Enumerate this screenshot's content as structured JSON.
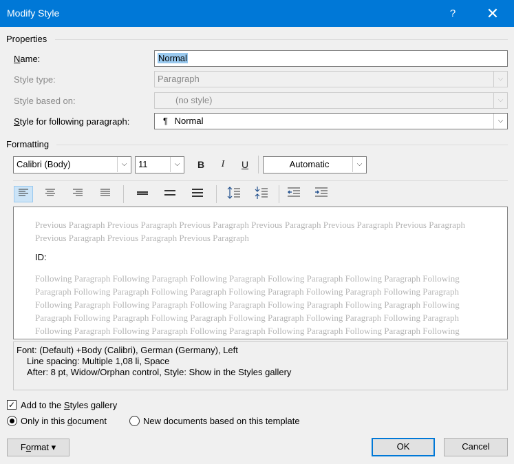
{
  "window": {
    "title": "Modify Style",
    "help_label": "?",
    "close_label": "✕"
  },
  "properties": {
    "header": "Properties",
    "name_label": "Name:",
    "name_value": "Normal",
    "style_type_label": "Style type:",
    "style_type_value": "Paragraph",
    "based_on_label": "Style based on:",
    "based_on_value": "(no style)",
    "following_label": "Style for following paragraph:",
    "following_value": "Normal",
    "pilcrow": "¶"
  },
  "formatting": {
    "header": "Formatting",
    "font": "Calibri (Body)",
    "size": "11",
    "bold": "B",
    "italic": "I",
    "underline": "U",
    "color": "Automatic"
  },
  "preview": {
    "previous_text": "Previous Paragraph Previous Paragraph Previous Paragraph Previous Paragraph Previous Paragraph Previous Paragraph Previous Paragraph Previous Paragraph Previous Paragraph",
    "current_text": "ID:",
    "following_text": "Following Paragraph Following Paragraph Following Paragraph Following Paragraph Following Paragraph Following Paragraph Following Paragraph Following Paragraph Following Paragraph Following Paragraph Following Paragraph Following Paragraph Following Paragraph Following Paragraph Following Paragraph Following Paragraph Following Paragraph Following Paragraph Following Paragraph Following Paragraph Following Paragraph Following Paragraph Following Paragraph Following Paragraph Following Paragraph Following Paragraph Following Paragraph Following Paragraph Following Paragraph Following Paragraph"
  },
  "description": {
    "line1": "Font: (Default) +Body (Calibri), German (Germany), Left",
    "line2": "Line spacing:  Multiple 1,08 li, Space",
    "line3": "After:  8 pt, Widow/Orphan control, Style: Show in the Styles gallery"
  },
  "options": {
    "add_to_gallery": "Add to the Styles gallery",
    "only_this_document": "Only in this document",
    "new_documents": "New documents based on this template"
  },
  "buttons": {
    "format": "Format",
    "ok": "OK",
    "cancel": "Cancel"
  },
  "colors": {
    "titlebar": "#0078d7",
    "selection": "#99c9ef",
    "default_border": "#0078d7"
  }
}
